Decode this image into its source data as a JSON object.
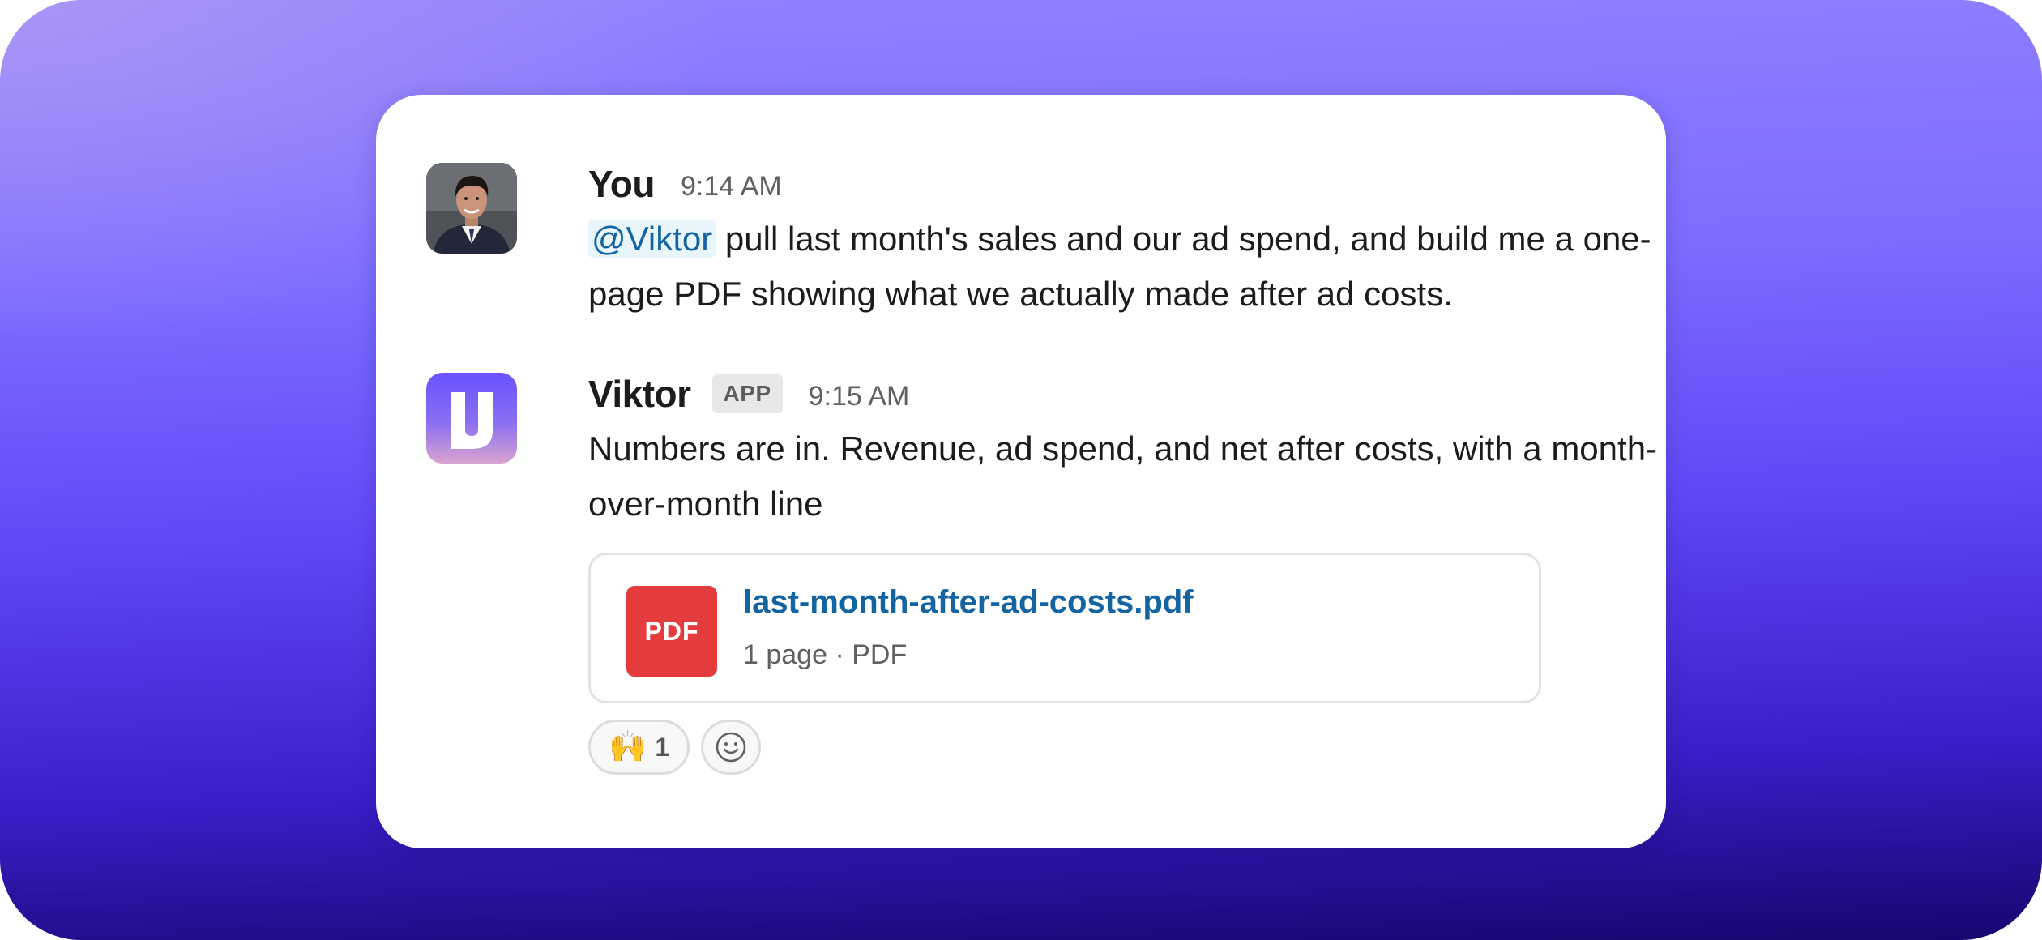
{
  "messages": {
    "you": {
      "name": "You",
      "time": "9:14 AM",
      "mention": "@Viktor",
      "text": " pull last month's sales and our ad spend, and build me a one-page PDF showing what we actually made after ad costs."
    },
    "viktor": {
      "name": "Viktor",
      "badge": "APP",
      "time": "9:15 AM",
      "text": "Numbers are in. Revenue, ad spend, and net after costs, with a month-over-month line",
      "attachment": {
        "icon_label": "PDF",
        "file_name": "last-month-after-ad-costs.pdf",
        "meta": "1 page · PDF"
      },
      "reactions": [
        {
          "emoji": "🙌",
          "icon": "raised-hands-emoji",
          "count": "1"
        }
      ],
      "add_reaction_icon": "smiley-face-icon"
    }
  },
  "colors": {
    "mention": "#1264a3",
    "mention_bg": "#e8f5fa",
    "pdf_red": "#e43c3c",
    "link": "#1264a3"
  }
}
